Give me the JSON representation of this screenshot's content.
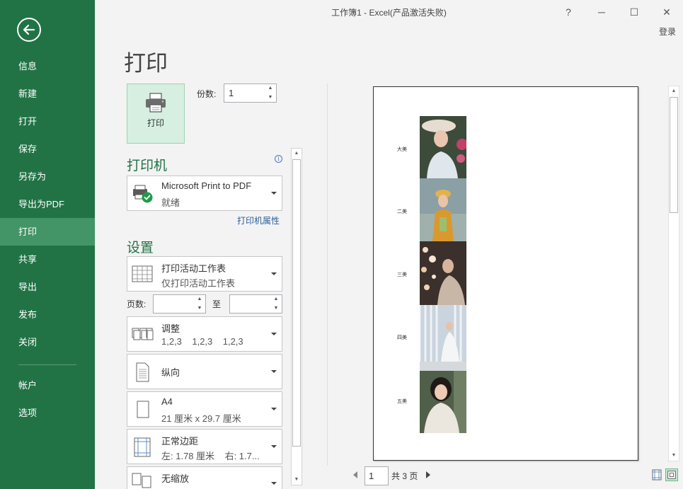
{
  "window": {
    "title": "工作簿1 - Excel(产品激活失败)",
    "help": "?",
    "minimize": "─",
    "maximize": "☐",
    "close": "✕",
    "login": "登录"
  },
  "sidebar": {
    "items": [
      {
        "label": "信息"
      },
      {
        "label": "新建"
      },
      {
        "label": "打开"
      },
      {
        "label": "保存"
      },
      {
        "label": "另存为"
      },
      {
        "label": "导出为PDF"
      },
      {
        "label": "打印",
        "active": true
      },
      {
        "label": "共享"
      },
      {
        "label": "导出"
      },
      {
        "label": "发布"
      },
      {
        "label": "关闭"
      }
    ],
    "bottom_items": [
      {
        "label": "帐户"
      },
      {
        "label": "选项"
      }
    ]
  },
  "print": {
    "heading": "打印",
    "button_label": "打印",
    "copies_label": "份数:",
    "copies_value": "1"
  },
  "printer": {
    "section_title": "打印机",
    "name": "Microsoft Print to PDF",
    "status": "就绪",
    "properties_link": "打印机属性"
  },
  "settings": {
    "section_title": "设置",
    "scope": {
      "line1": "打印活动工作表",
      "line2": "仅打印活动工作表"
    },
    "pages_label": "页数:",
    "pages_from": "",
    "to_label": "至",
    "pages_to": "",
    "collate": {
      "line1": "调整",
      "line2": "1,2,3    1,2,3    1,2,3"
    },
    "orientation": {
      "line1": "纵向"
    },
    "paper": {
      "line1": "A4",
      "line2": "21 厘米 x 29.7 厘米"
    },
    "margins": {
      "line1": "正常边距",
      "line2": "左: 1.78 厘米    右: 1.7..."
    },
    "scaling": {
      "line1": "无缩放"
    }
  },
  "preview": {
    "rows": [
      {
        "label": "大美"
      },
      {
        "label": "二美"
      },
      {
        "label": "三美"
      },
      {
        "label": "四美"
      },
      {
        "label": "五美"
      }
    ],
    "current_page": "1",
    "total_pages": "共 3 页"
  },
  "colors": {
    "brand": "#217346",
    "active_nav": "#439467",
    "heading_green": "#217346",
    "link_blue": "#2e5c9b"
  },
  "icons": [
    "back-arrow-icon",
    "printer-icon",
    "printer-ready-icon",
    "sheet-grid-icon",
    "collate-icon",
    "portrait-icon",
    "paper-icon",
    "margins-icon",
    "no-scaling-icon",
    "info-icon",
    "show-margins-icon",
    "zoom-page-icon"
  ]
}
